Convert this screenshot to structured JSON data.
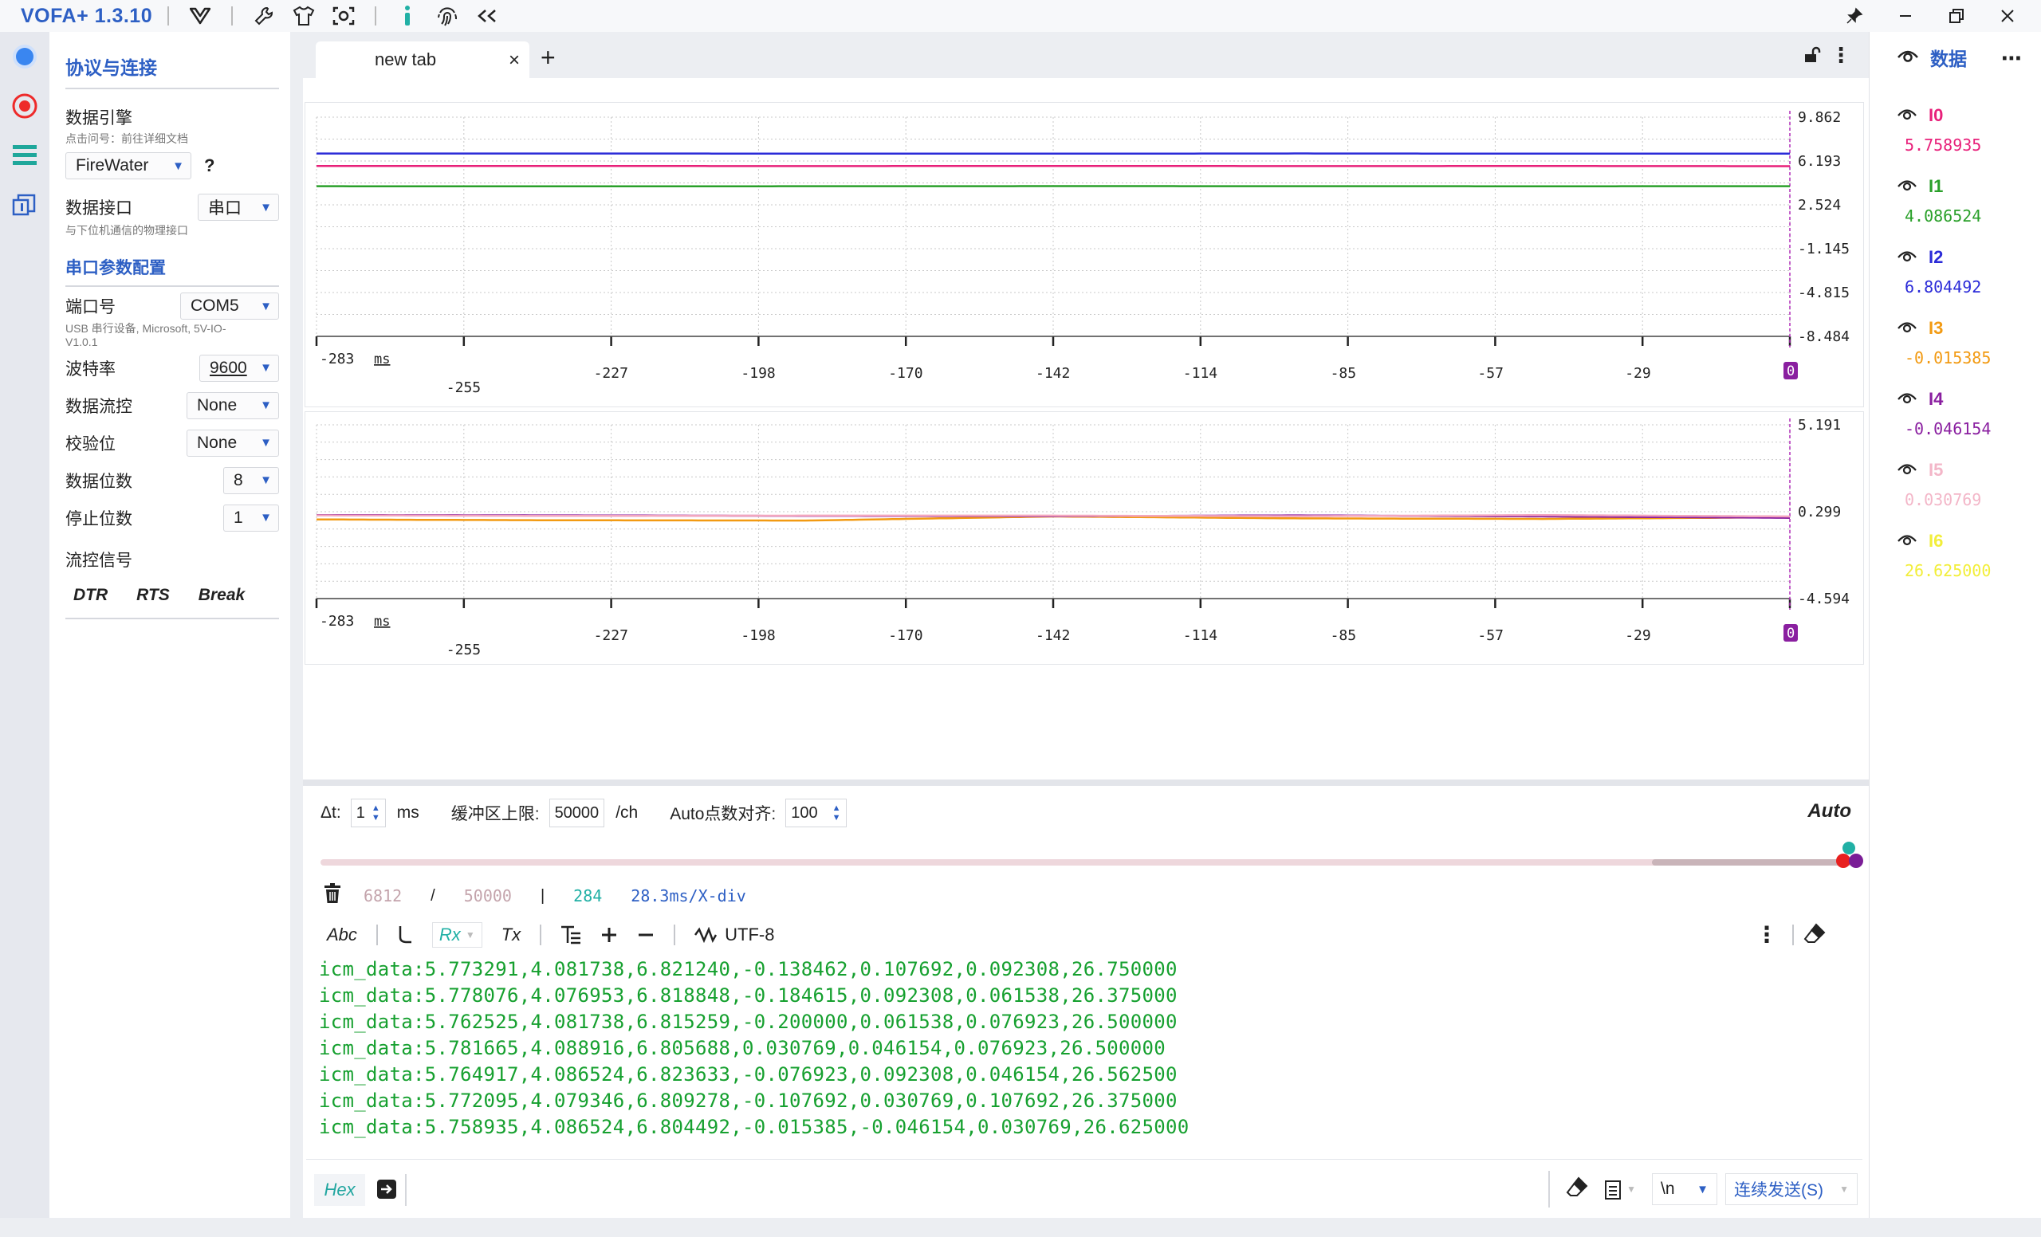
{
  "app": {
    "title": "VOFA+ 1.3.10"
  },
  "config": {
    "protocol_title": "协议与连接",
    "engine_label": "数据引擎",
    "engine_hint": "点击问号：前往详细文档",
    "engine_value": "FireWater",
    "help": "?",
    "iface_label": "数据接口",
    "iface_hint": "与下位机通信的物理接口",
    "iface_value": "串口",
    "serial_title": "串口参数配置",
    "port_label": "端口号",
    "port_value": "COM5",
    "port_hint": "USB 串行设备, Microsoft, 5V-IO-V1.0.1",
    "baud_label": "波特率",
    "baud_value": "9600",
    "flow_label": "数据流控",
    "flow_value": "None",
    "parity_label": "校验位",
    "parity_value": "None",
    "databits_label": "数据位数",
    "databits_value": "8",
    "stopbits_label": "停止位数",
    "stopbits_value": "1",
    "signal_label": "流控信号",
    "signals": [
      "DTR",
      "RTS",
      "Break"
    ]
  },
  "tab": {
    "label": "new tab",
    "close": "×",
    "add": "+"
  },
  "chart_data": [
    {
      "type": "line",
      "ylim": [
        -8.484,
        9.862
      ],
      "yticks": [
        "9.862",
        "6.193",
        "2.524",
        "-1.145",
        "-4.815",
        "-8.484"
      ],
      "x_unit": "ms",
      "xticks": [
        "-283",
        "-255",
        "-227",
        "-198",
        "-170",
        "-142",
        "-114",
        "-85",
        "-57",
        "-29",
        "0"
      ],
      "series": [
        {
          "name": "I0",
          "color": "#e8207a",
          "values": [
            5.773,
            5.778,
            5.763,
            5.782,
            5.765,
            5.772,
            5.759
          ]
        },
        {
          "name": "I1",
          "color": "#2aa02a",
          "values": [
            4.082,
            4.077,
            4.082,
            4.089,
            4.087,
            4.079,
            4.087
          ]
        },
        {
          "name": "I2",
          "color": "#2b2bd8",
          "values": [
            6.821,
            6.819,
            6.815,
            6.806,
            6.824,
            6.809,
            6.804
          ]
        }
      ]
    },
    {
      "type": "line",
      "ylim": [
        -4.594,
        5.191
      ],
      "yticks": [
        "5.191",
        "0.299",
        "-4.594"
      ],
      "x_unit": "ms",
      "xticks": [
        "-283",
        "-255",
        "-227",
        "-198",
        "-170",
        "-142",
        "-114",
        "-85",
        "-57",
        "-29",
        "0"
      ],
      "series": [
        {
          "name": "I3",
          "color": "#f29a12",
          "values": [
            -0.138,
            -0.185,
            -0.2,
            0.031,
            -0.077,
            -0.108,
            -0.015
          ]
        },
        {
          "name": "I4",
          "color": "#8a1fa0",
          "values": [
            0.108,
            0.092,
            0.062,
            0.046,
            0.092,
            0.031,
            -0.046
          ]
        },
        {
          "name": "I5",
          "color": "#f3a6be",
          "values": [
            0.092,
            0.062,
            0.077,
            0.077,
            0.046,
            0.108,
            0.031
          ]
        }
      ]
    }
  ],
  "controls": {
    "dt_label": "Δt:",
    "dt_value": "1",
    "dt_unit": "ms",
    "buffer_label": "缓冲区上限:",
    "buffer_value": "50000",
    "buffer_unit": "/ch",
    "align_label": "Auto点数对齐:",
    "align_value": "100",
    "auto": "Auto"
  },
  "stats": {
    "count": "6812",
    "slash": "/",
    "limit": "50000",
    "sep": "|",
    "points": "284",
    "scale": "28.3ms/X-div"
  },
  "rx_toolbar": {
    "abc": "Abc",
    "rx": "Rx",
    "tx": "Tx",
    "encoding": "UTF-8"
  },
  "rx_lines": [
    "icm_data:5.773291,4.081738,6.821240,-0.138462,0.107692,0.092308,26.750000",
    "icm_data:5.778076,4.076953,6.818848,-0.184615,0.092308,0.061538,26.375000",
    "icm_data:5.762525,4.081738,6.815259,-0.200000,0.061538,0.076923,26.500000",
    "icm_data:5.781665,4.088916,6.805688,0.030769,0.046154,0.076923,26.500000",
    "icm_data:5.764917,4.086524,6.823633,-0.076923,0.092308,0.046154,26.562500",
    "icm_data:5.772095,4.079346,6.809278,-0.107692,0.030769,0.107692,26.375000",
    "icm_data:5.758935,4.086524,6.804492,-0.015385,-0.046154,0.030769,26.625000"
  ],
  "send": {
    "hex": "Hex",
    "newline": "\\n",
    "send_button": "连续发送(S)"
  },
  "data_panel": {
    "title": "数据",
    "channels": [
      {
        "name": "I0",
        "value": "5.758935",
        "color": "#e8207a"
      },
      {
        "name": "I1",
        "value": "4.086524",
        "color": "#2aa02a"
      },
      {
        "name": "I2",
        "value": "6.804492",
        "color": "#2b2bd8"
      },
      {
        "name": "I3",
        "value": "-0.015385",
        "color": "#f29a12"
      },
      {
        "name": "I4",
        "value": "-0.046154",
        "color": "#8a1fa0"
      },
      {
        "name": "I5",
        "value": "0.030769",
        "color": "#f3b6c8"
      },
      {
        "name": "I6",
        "value": "26.625000",
        "color": "#f2ee3a"
      }
    ]
  }
}
